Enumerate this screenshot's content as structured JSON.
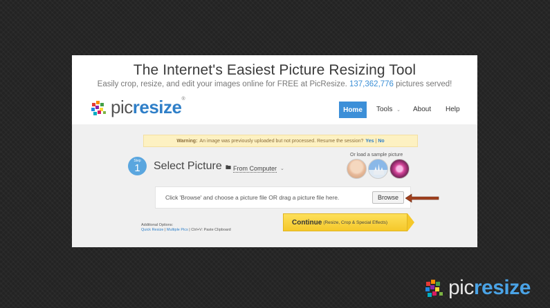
{
  "header": {
    "title": "The Internet's Easiest Picture Resizing Tool",
    "subtitle_prefix": "Easily crop, resize, and edit your images online for FREE at PicResize.",
    "served_count": "137,362,776",
    "subtitle_suffix": "pictures served!"
  },
  "logo": {
    "part1": "pic",
    "part2": "resize",
    "reg": "®"
  },
  "nav": {
    "home": "Home",
    "tools": "Tools",
    "about": "About",
    "help": "Help"
  },
  "warning": {
    "label": "Warning:",
    "text": "An image was previously uploaded but not processed. Resume the session?",
    "yes": "Yes",
    "sep": "|",
    "no": "No"
  },
  "step": {
    "label": "Step",
    "number": "1",
    "title": "Select Picture"
  },
  "source": {
    "value": "From Computer"
  },
  "samples": {
    "label": "Or load a sample picture"
  },
  "upload": {
    "prompt": "Click 'Browse' and choose a picture file OR drag a picture file here.",
    "browse": "Browse"
  },
  "options": {
    "label": "Additional Options:",
    "quick": "Quick Resize",
    "sep1": " | ",
    "multiple": "Multiple Pics",
    "sep2": " | ",
    "clipboard": "Ctrl+V: Paste Clipboard"
  },
  "continue": {
    "label": "Continue",
    "sub": "(Resize, Crop & Special Effects)"
  },
  "brand": {
    "part1": "pic",
    "part2": "resize"
  },
  "colors": {
    "accent": "#3c8fd8",
    "continue": "#f5c82a",
    "arrow": "#a0401e"
  }
}
